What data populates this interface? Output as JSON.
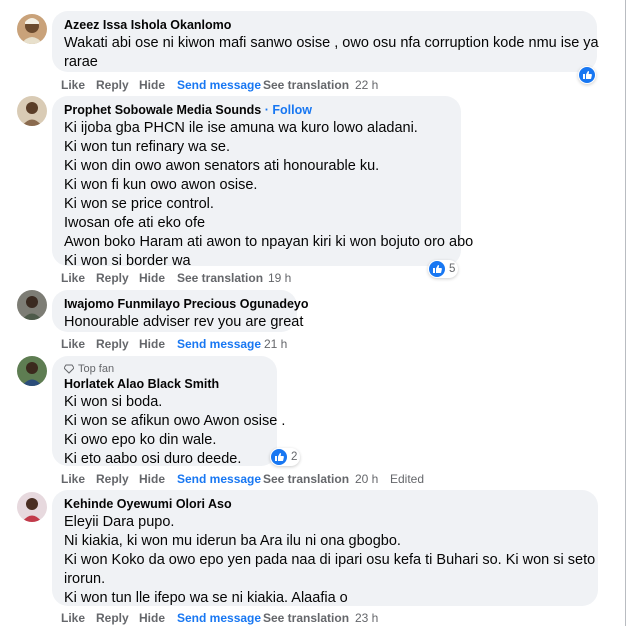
{
  "colors": {
    "link": "#1877f2",
    "meta": "#65676b",
    "bubble": "#f0f2f5"
  },
  "comments": [
    {
      "name": "Azeez Issa Ishola Okanlomo",
      "lines": [
        "Wakati abi ose ni kiwon mafi sanwo osise , owo osu nfa corruption kode nmu ise ya",
        "rarae"
      ],
      "actions": {
        "like": "Like",
        "reply": "Reply",
        "hide": "Hide",
        "send": "Send message",
        "translate": "See translation",
        "time": "22 h"
      },
      "reactions": {
        "icon": "like-icon",
        "count": ""
      }
    },
    {
      "name": "Prophet Sobowale Media Sounds",
      "follow": "· Follow",
      "lines": [
        "Ki ijoba gba PHCN ile ise amuna wa kuro lowo aladani.",
        "Ki won tun refinary wa se.",
        "Ki won din owo awon senators ati honourable ku.",
        "Ki won fi kun owo awon osise.",
        "Ki won se price control.",
        "Iwosan ofe ati eko ofe",
        "Awon boko Haram ati awon to npayan kiri ki won bojuto oro abo",
        "Ki won si border wa"
      ],
      "actions": {
        "like": "Like",
        "reply": "Reply",
        "hide": "Hide",
        "translate": "See translation",
        "time": "19 h"
      },
      "reactions": {
        "icon": "like-icon",
        "count": "5"
      }
    },
    {
      "name": "Iwajomo Funmilayo Precious Ogunadeyo",
      "lines": [
        "Honourable adviser rev you are great"
      ],
      "actions": {
        "like": "Like",
        "reply": "Reply",
        "hide": "Hide",
        "send": "Send message",
        "time": "21 h"
      }
    },
    {
      "badge": "Top fan",
      "name": "Horlatek Alao Black Smith",
      "lines": [
        "Ki won si boda.",
        "Ki won se afikun owo Awon osise .",
        "Ki owo epo ko din wale.",
        "Ki eto aabo osi duro deede."
      ],
      "actions": {
        "like": "Like",
        "reply": "Reply",
        "hide": "Hide",
        "send": "Send message",
        "translate": "See translation",
        "time": "20 h",
        "edited": "Edited"
      },
      "reactions": {
        "icon": "like-icon",
        "count": "2"
      }
    },
    {
      "name": "Kehinde Oyewumi Olori Aso",
      "lines": [
        "Eleyii Dara pupo.",
        "Ni kiakia, ki won mu iderun ba Ara ilu ni ona gbogbo.",
        "Ki won Koko da owo epo yen pada naa di ipari osu kefa ti Buhari so. Ki won si seto",
        "irorun.",
        "Ki won tun lle ifepo wa se ni kiakia. Alaafia o"
      ],
      "actions": {
        "like": "Like",
        "reply": "Reply",
        "hide": "Hide",
        "send": "Send message",
        "translate": "See translation",
        "time": "23 h"
      }
    }
  ]
}
